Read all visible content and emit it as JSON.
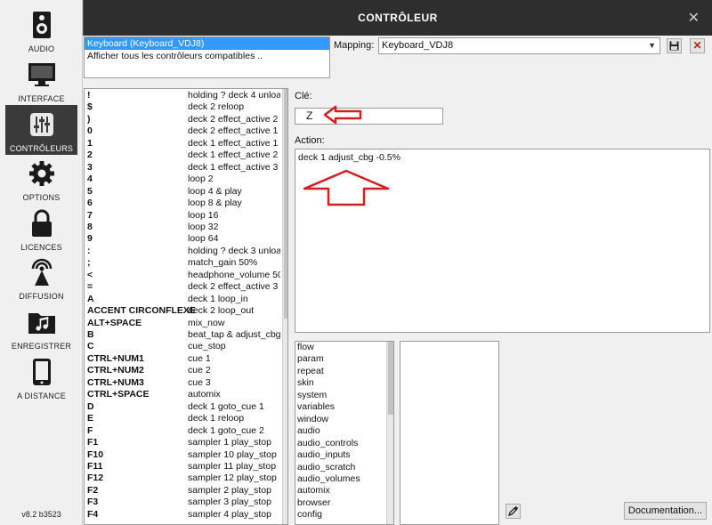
{
  "window": {
    "title": "CONTRÔLEUR"
  },
  "sidebar": {
    "items": [
      {
        "label": "AUDIO",
        "icon": "speaker-icon"
      },
      {
        "label": "INTERFACE",
        "icon": "monitor-icon"
      },
      {
        "label": "CONTRÔLEURS",
        "icon": "sliders-icon",
        "active": true
      },
      {
        "label": "OPTIONS",
        "icon": "gear-icon"
      },
      {
        "label": "LICENCES",
        "icon": "lock-icon"
      },
      {
        "label": "DIFFUSION",
        "icon": "broadcast-icon"
      },
      {
        "label": "ENREGISTRER",
        "icon": "music-folder-icon"
      },
      {
        "label": "A DISTANCE",
        "icon": "tablet-icon"
      }
    ],
    "version": "v8.2 b3523"
  },
  "controllers": {
    "items": [
      "Keyboard (Keyboard_VDJ8)",
      "Afficher tous les contrôleurs compatibles .."
    ],
    "selected_index": 0
  },
  "mapping": {
    "label": "Mapping:",
    "value": "Keyboard_VDJ8"
  },
  "keymap": [
    {
      "key": "!",
      "action": "holding ? deck 4 unload"
    },
    {
      "key": "$",
      "action": "deck 2 reloop"
    },
    {
      "key": ")",
      "action": "deck 2 effect_active 2"
    },
    {
      "key": "0",
      "action": "deck 2 effect_active 1"
    },
    {
      "key": "1",
      "action": "deck 1 effect_active 1"
    },
    {
      "key": "2",
      "action": "deck 1 effect_active 2"
    },
    {
      "key": "3",
      "action": "deck 1 effect_active 3"
    },
    {
      "key": "4",
      "action": "loop 2"
    },
    {
      "key": "5",
      "action": "loop 4 & play"
    },
    {
      "key": "6",
      "action": "loop 8 & play"
    },
    {
      "key": "7",
      "action": "loop 16"
    },
    {
      "key": "8",
      "action": "loop 32"
    },
    {
      "key": "9",
      "action": "loop 64"
    },
    {
      "key": ":",
      "action": "holding ? deck 3 unload"
    },
    {
      "key": ";",
      "action": "match_gain 50%"
    },
    {
      "key": "<",
      "action": "headphone_volume 50%"
    },
    {
      "key": "=",
      "action": "deck 2 effect_active 3"
    },
    {
      "key": "A",
      "action": "deck 1 loop_in"
    },
    {
      "key": "ACCENT CIRCONFLEXE",
      "action": "deck 2 loop_out"
    },
    {
      "key": "ALT+SPACE",
      "action": "mix_now"
    },
    {
      "key": "B",
      "action": "beat_tap & adjust_cbg"
    },
    {
      "key": "C",
      "action": "cue_stop"
    },
    {
      "key": "CTRL+NUM1",
      "action": "cue 1"
    },
    {
      "key": "CTRL+NUM2",
      "action": "cue 2"
    },
    {
      "key": "CTRL+NUM3",
      "action": "cue 3"
    },
    {
      "key": "CTRL+SPACE",
      "action": "automix"
    },
    {
      "key": "D",
      "action": "deck 1 goto_cue 1"
    },
    {
      "key": "E",
      "action": "deck 1 reloop"
    },
    {
      "key": "F",
      "action": "deck 1 goto_cue 2"
    },
    {
      "key": "F1",
      "action": "sampler 1 play_stop"
    },
    {
      "key": "F10",
      "action": "sampler 10 play_stop"
    },
    {
      "key": "F11",
      "action": "sampler 11 play_stop"
    },
    {
      "key": "F12",
      "action": "sampler 12 play_stop"
    },
    {
      "key": "F2",
      "action": "sampler 2 play_stop"
    },
    {
      "key": "F3",
      "action": "sampler 3 play_stop"
    },
    {
      "key": "F4",
      "action": "sampler 4 play_stop"
    }
  ],
  "key_field": {
    "label": "Clé:",
    "value": "Z"
  },
  "action_field": {
    "label": "Action:",
    "value": "deck 1 adjust_cbg -0.5%"
  },
  "verbs": [
    "flow",
    "param",
    "repeat",
    "skin",
    "system",
    "variables",
    "window",
    "audio",
    "audio_controls",
    "audio_inputs",
    "audio_scratch",
    "audio_volumes",
    "automix",
    "browser",
    "config"
  ],
  "documentation_button": "Documentation...",
  "colors": {
    "accent_selection": "#3399ff",
    "annotation_red": "#d22020",
    "title_bar": "#2e2e2e"
  }
}
